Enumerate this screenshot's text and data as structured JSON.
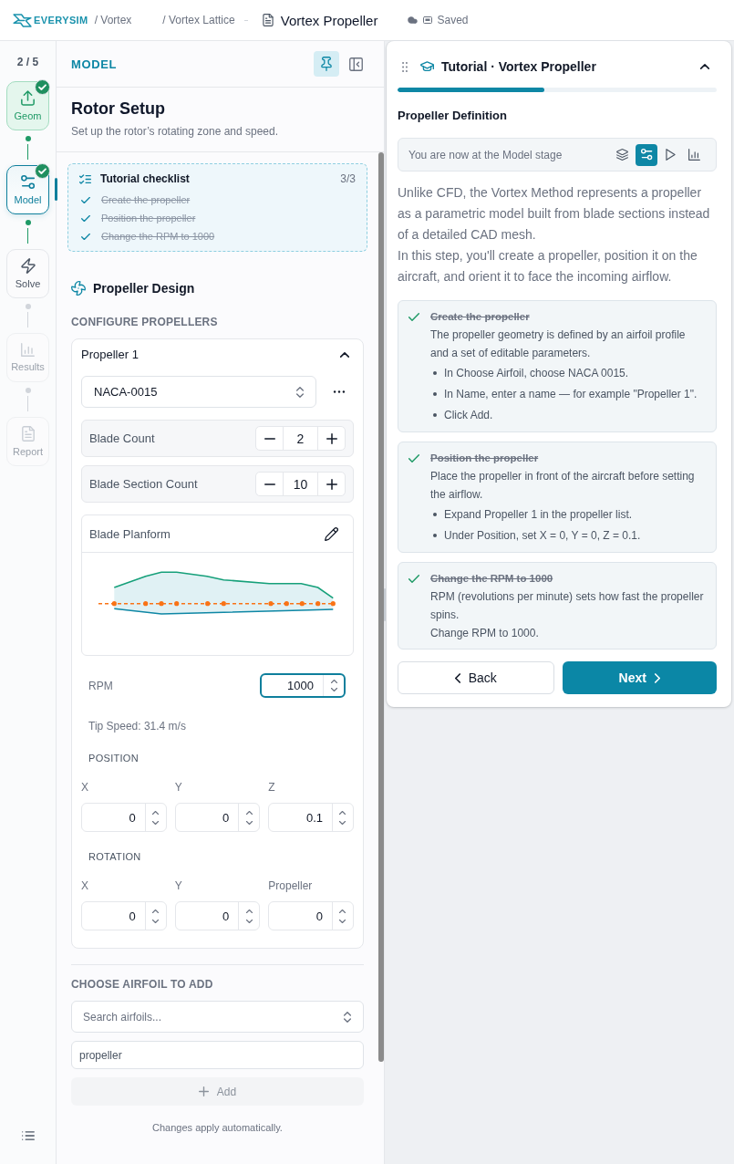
{
  "header": {
    "logo": "EVERYSIM",
    "breadcrumbs": [
      "/ Vortex",
      "/ Vortex Lattice"
    ],
    "document_title": "Vortex Propeller",
    "save_status": "Saved"
  },
  "rail": {
    "step_counter": "2 / 5",
    "steps": [
      {
        "label": "Geom",
        "completed": true,
        "selected": false,
        "disabled": false
      },
      {
        "label": "Model",
        "completed": true,
        "selected": true,
        "disabled": false
      },
      {
        "label": "Solve",
        "completed": false,
        "selected": false,
        "disabled": false
      },
      {
        "label": "Results",
        "completed": false,
        "selected": false,
        "disabled": true
      },
      {
        "label": "Report",
        "completed": false,
        "selected": false,
        "disabled": true
      }
    ]
  },
  "panel": {
    "title": "MODEL",
    "pinned": true,
    "heading": "Rotor Setup",
    "subtitle": "Set up the rotor’s rotating zone and speed.",
    "checklist": {
      "title": "Tutorial checklist",
      "count": "3/3",
      "items": [
        {
          "label": "Create the propeller",
          "done": true
        },
        {
          "label": "Position the propeller",
          "done": true
        },
        {
          "label": "Change the RPM to 1000",
          "done": true
        }
      ]
    },
    "section_title": "Propeller Design",
    "configure_label": "CONFIGURE PROPELLERS",
    "propeller": {
      "name": "Propeller 1",
      "expanded": true,
      "airfoil": "NACA-0015",
      "counters": [
        {
          "label": "Blade Count",
          "value": "2"
        },
        {
          "label": "Blade Section Count",
          "value": "10"
        }
      ],
      "planform_title": "Blade Planform",
      "rpm": {
        "label": "RPM",
        "value": "1000",
        "focused": true
      },
      "tip_speed": "Tip Speed: 31.4 m/s",
      "position": {
        "title": "POSITION",
        "fields": [
          {
            "label": "X",
            "value": "0"
          },
          {
            "label": "Y",
            "value": "0"
          },
          {
            "label": "Z",
            "value": "0.1"
          }
        ]
      },
      "rotation": {
        "title": "ROTATION",
        "fields": [
          {
            "label": "X",
            "value": "0"
          },
          {
            "label": "Y",
            "value": "0"
          },
          {
            "label": "Propeller",
            "value": "0"
          }
        ]
      }
    },
    "add_airfoil": {
      "title": "CHOOSE AIRFOIL TO ADD",
      "search_placeholder": "Search airfoils...",
      "name_value": "propeller",
      "add_label": "Add",
      "add_disabled": true,
      "note": "Changes apply automatically."
    }
  },
  "tutorial": {
    "title": "Tutorial · Vortex Propeller",
    "expanded": true,
    "progress": {
      "level": 0.46
    },
    "step_title": "Propeller Definition",
    "stage_text": "You are now at the Model stage",
    "stages": [
      {
        "selected": false
      },
      {
        "selected": true
      },
      {
        "selected": false
      },
      {
        "selected": false
      }
    ],
    "intro": [
      "Unlike CFD, the Vortex Method represents a propeller as a parametric model built from blade sections instead of a detailed CAD mesh.",
      "In this step, you'll create a propeller, position it on the aircraft, and orient it to face the incoming airflow."
    ],
    "tasks": [
      {
        "title": "Create the propeller",
        "done": true,
        "description": [
          "The propeller geometry is defined by an airfoil profile and a set of editable parameters."
        ],
        "bullets": [
          "In Choose Airfoil, choose NACA 0015.",
          "In Name, enter a name — for example \"Propeller 1\".",
          "Click Add."
        ]
      },
      {
        "title": "Position the propeller",
        "done": true,
        "description": [
          "Place the propeller in front of the aircraft before setting the airflow."
        ],
        "bullets": [
          "Expand Propeller 1 in the propeller list.",
          "Under Position, set X = 0, Y = 0, Z = 0.1."
        ]
      },
      {
        "title": "Change the RPM to 1000",
        "done": true,
        "description": [
          "RPM (revolutions per minute) sets how fast the propeller spins.",
          "Change RPM to 1000."
        ]
      }
    ],
    "back_label": "Back",
    "next_label": "Next"
  }
}
